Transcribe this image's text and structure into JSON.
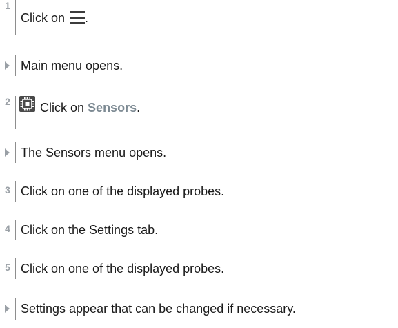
{
  "steps": [
    {
      "marker": "1",
      "kind": "number",
      "text_before": "Click on",
      "icon": "hamburger-menu-icon",
      "text_after": "."
    },
    {
      "marker": "arrow",
      "kind": "result",
      "text": "Main menu opens."
    },
    {
      "marker": "2",
      "kind": "number",
      "icon": "sensors-chip-icon",
      "text_before": "Click on",
      "highlight": "Sensors",
      "text_after": "."
    },
    {
      "marker": "arrow",
      "kind": "result",
      "text": "The Sensors menu opens."
    },
    {
      "marker": "3",
      "kind": "number",
      "text": "Click on one of the displayed probes."
    },
    {
      "marker": "4",
      "kind": "number",
      "text": "Click on the Settings tab."
    },
    {
      "marker": "5",
      "kind": "number",
      "text": "Click on one of the displayed probes."
    },
    {
      "marker": "arrow",
      "kind": "result",
      "text": "Settings appear that can be changed if necessary."
    }
  ],
  "colors": {
    "marker": "#9aa0a6",
    "highlight": "#7d8a93",
    "text": "#1a1a1a",
    "divider": "#8e8e8e"
  }
}
